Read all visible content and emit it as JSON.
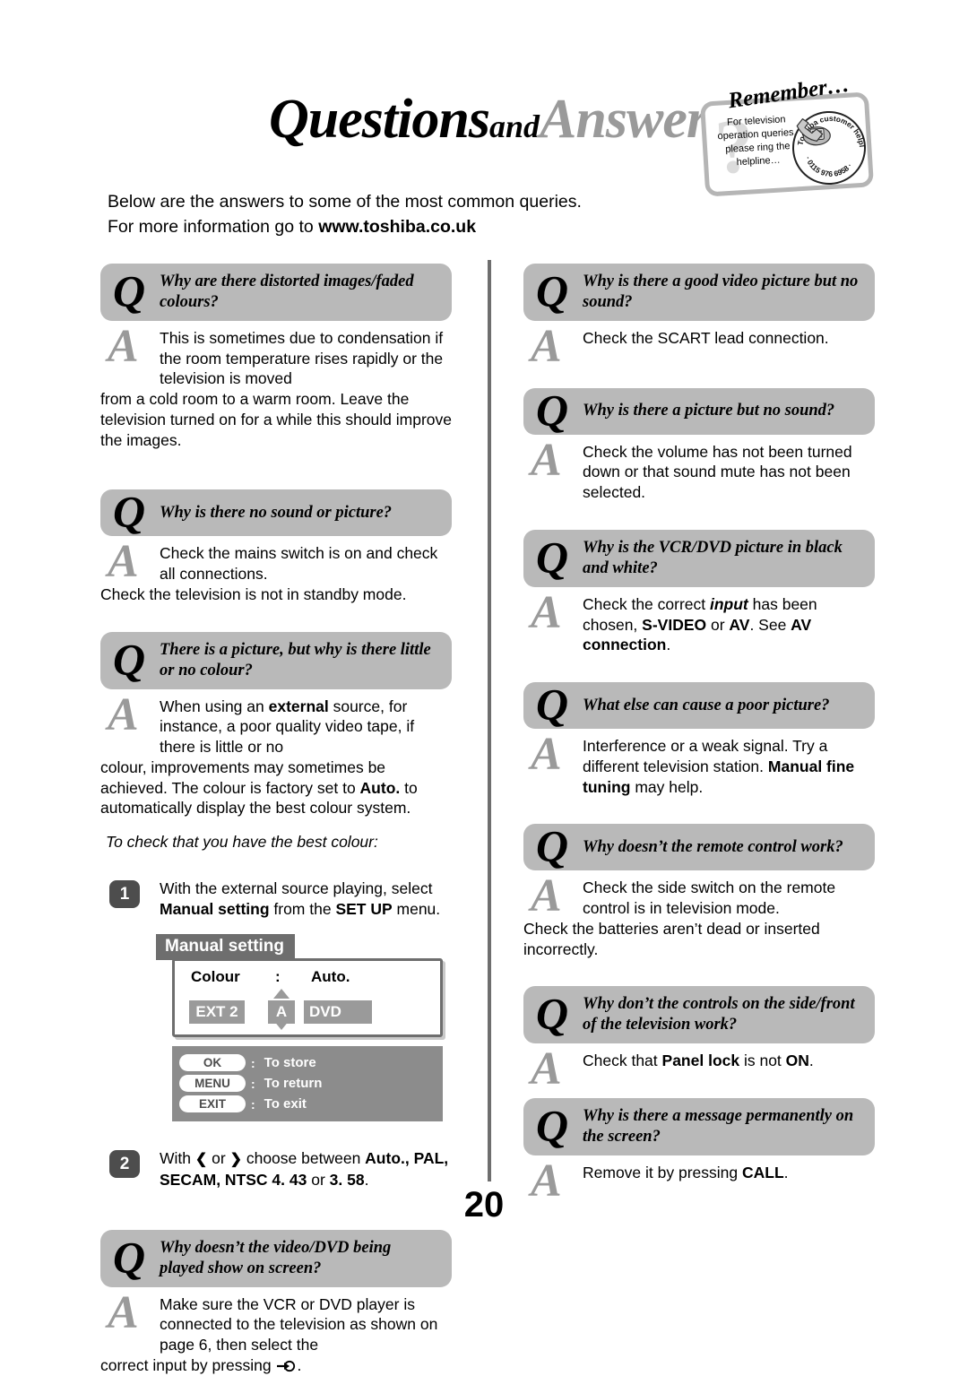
{
  "header": {
    "title_q": "Questions",
    "title_and": "and",
    "title_a": "Answers"
  },
  "remember_badge": {
    "word": "Remember…",
    "question_mark": "?",
    "body": "For television operation queries, please ring the helpline…",
    "seal_top": "Toshiba customer helpline",
    "seal_bottom": "· 0115 976 6958 ·",
    "phone_icon": "telephone-icon"
  },
  "intro": {
    "line1": "Below are the answers to some of the most common queries.",
    "line2_prefix": "For more information go to ",
    "url": "www.toshiba.co.uk"
  },
  "glyphs": {
    "q": "Q",
    "a": "A",
    "chevron_left": "❮",
    "chevron_right": "❯"
  },
  "left_column": [
    {
      "type": "qa",
      "question": "Why are there distorted images/faded colours?",
      "answer_indented": "This is sometimes due to condensation if the room temperature rises rapidly or the television is moved",
      "answer_full": "from a cold room to a warm room. Leave the television turned on for a while this should improve the images."
    },
    {
      "type": "qa",
      "question": "Why is there no sound or picture?",
      "answer_indented": "Check the mains switch is on and check all connections.",
      "answer_full": "Check the television is not in standby mode."
    },
    {
      "type": "qa",
      "question": "There is a picture, but why is there little or no colour?",
      "answer_indented_html": "When using an <b>external</b> source, for instance, a poor quality video tape, if there is little or no",
      "answer_full_html": "colour, improvements may sometimes be achieved. The colour is factory set to <b>Auto.</b> to automatically display the best colour system."
    }
  ],
  "best_colour_note": "To check that you have the best colour:",
  "steps": [
    {
      "number": "1",
      "text_html": "With the external source playing, select <b>Manual setting</b> from the <b>SET UP</b> menu."
    },
    {
      "number": "2",
      "text_html": "With <span class=\"chev\">❮</span> or <span class=\"chev\">❯</span> choose between <b>Auto., PAL, SECAM, NTSC 4. 43</b> or <b>3. 58</b>."
    }
  ],
  "osd": {
    "title": "Manual setting",
    "row_label": "Colour",
    "row_colon": ":",
    "row_value": "Auto.",
    "chip_left": "EXT 2",
    "chip_middle": "A",
    "chip_right": "DVD",
    "arrow_up": "triangle-up-icon",
    "arrow_down": "triangle-down-icon",
    "legend": [
      {
        "key": "OK",
        "colon": ":",
        "action": "To store"
      },
      {
        "key": "MENU",
        "colon": ":",
        "action": "To return"
      },
      {
        "key": "EXIT",
        "colon": ":",
        "action": "To exit"
      }
    ]
  },
  "left_column_last": {
    "question": "Why doesn’t the video/DVD being played show on screen?",
    "answer_indented": "Make sure the VCR or DVD player is connected to the television as shown on page 6, then select the",
    "answer_full_prefix": "correct input by pressing ",
    "answer_full_suffix": "."
  },
  "right_column": [
    {
      "question": "Why is there a good video picture but no sound?",
      "answer_indented": "Check the SCART lead connection.",
      "answer_full": ""
    },
    {
      "question": "Why is there a picture but no sound?",
      "answer_indented": "Check the volume has not been turned down or that sound mute has not been selected.",
      "answer_full": ""
    },
    {
      "question": "Why is the VCR/DVD picture in black and white?",
      "answer_indented_html": "Check the correct <i class=\"bi\">input</i> has been chosen, <b>S-VIDEO</b> or <b>AV</b>. See <b>AV connection</b>.",
      "answer_full": ""
    },
    {
      "question": "What else can cause a poor picture?",
      "answer_indented_html": "Interference or a weak signal. Try a different television station. <b>Manual fine tuning</b> may help.",
      "answer_full": ""
    },
    {
      "question": "Why doesn’t the remote control work?",
      "answer_indented": "Check the side switch on the remote control is in television mode.",
      "answer_full": "Check the batteries aren’t dead or inserted incorrectly."
    },
    {
      "question": "Why don’t the controls on the side/front of the television work?",
      "answer_indented_html": "Check that <b>Panel lock</b> is not <b>ON</b>.",
      "answer_full": ""
    },
    {
      "question": "Why is there a message permanently on the screen?",
      "answer_indented_html": "Remove it by pressing <b>CALL</b>.",
      "answer_full": ""
    }
  ],
  "footer": {
    "page_number": "20"
  },
  "colors": {
    "q_bar": "#b9b9b9",
    "a_glyph": "#9a9a9a",
    "osd_title_bg": "#6e6e6e",
    "osd_chip": "#9a9a9a",
    "legend_bg": "#8c8c8c",
    "step_badge": "#4d4d4d",
    "divider": "#6e6e6e"
  }
}
